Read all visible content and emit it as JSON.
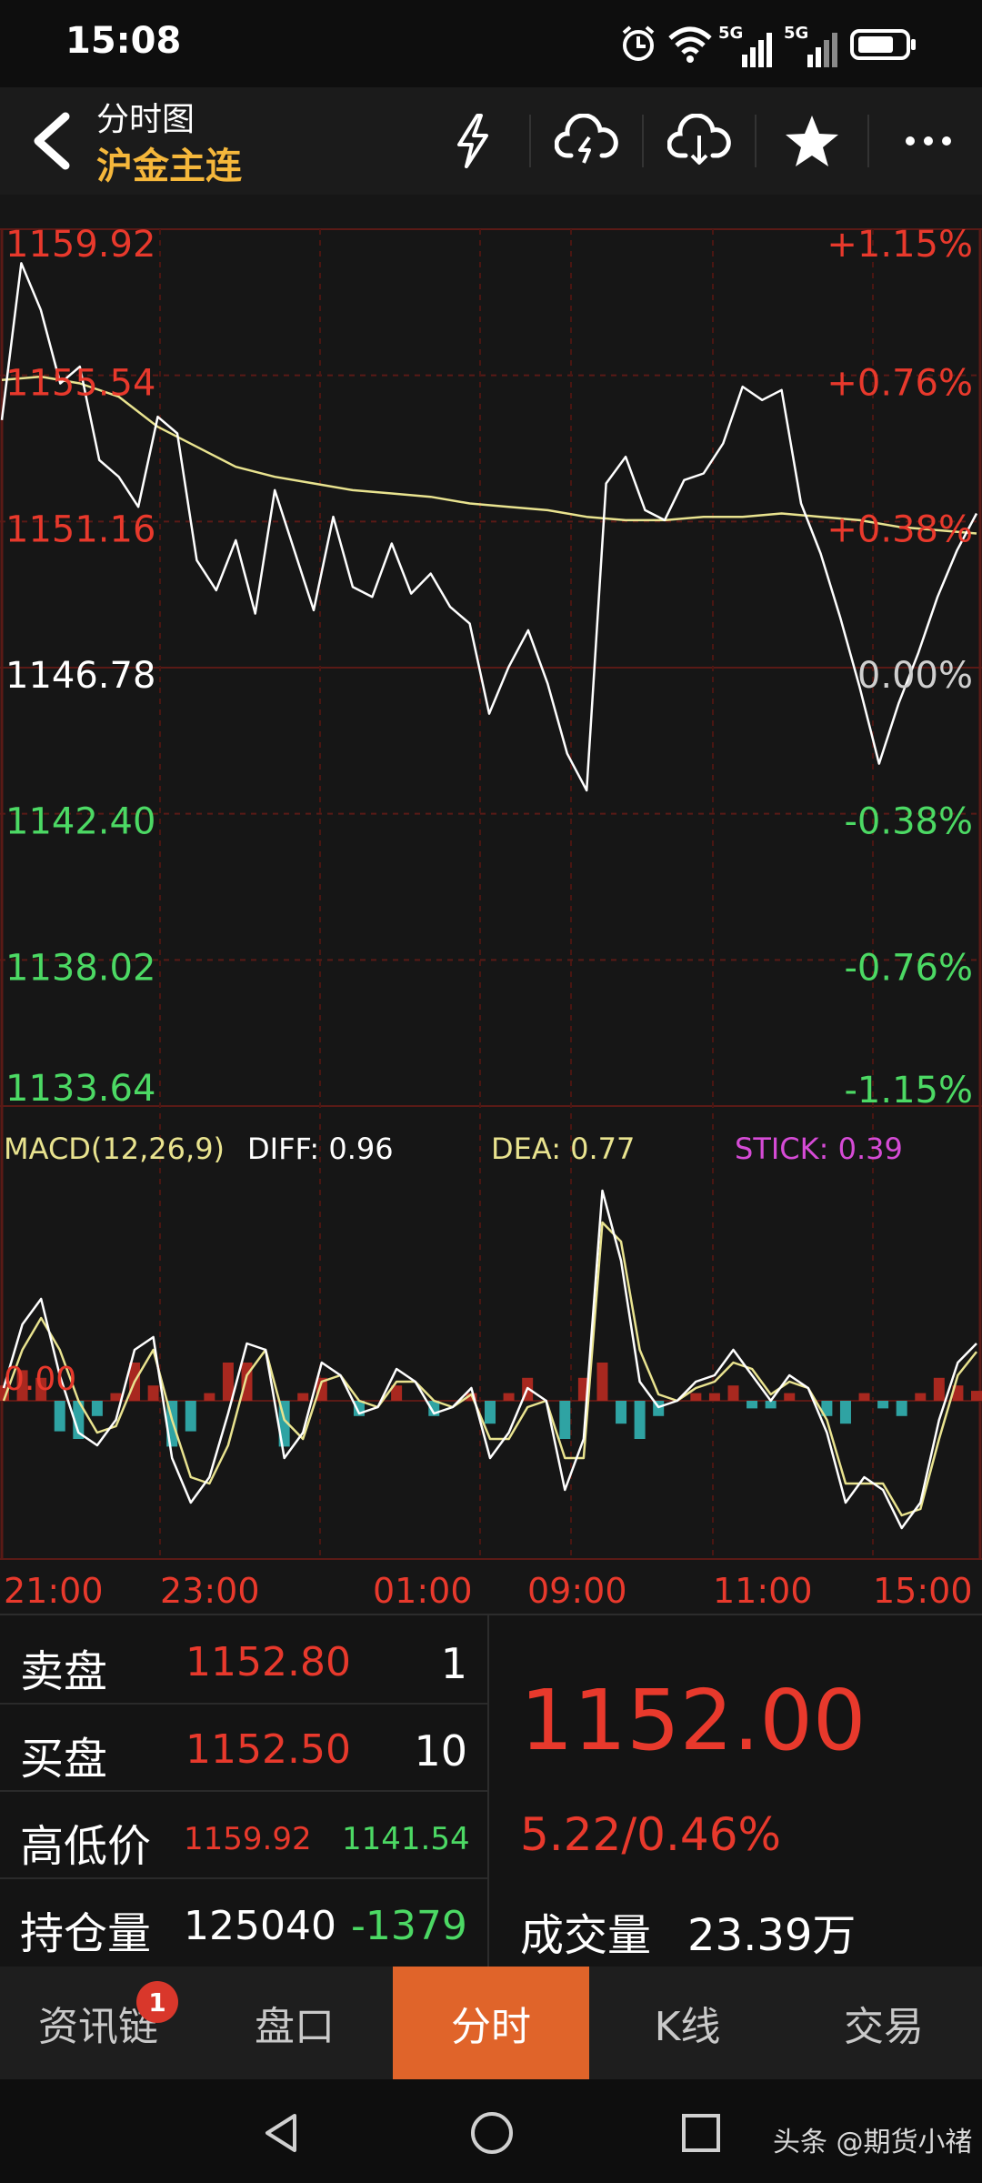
{
  "status_bar": {
    "time": "15:08",
    "net1": "5G",
    "net2": "5G"
  },
  "header": {
    "title": "分时图",
    "subtitle": "沪金主连",
    "icons": [
      "back-chevron-icon",
      "lightning-icon",
      "cloud-upload-icon",
      "cloud-download-icon",
      "star-icon",
      "more-icon"
    ]
  },
  "chart": {
    "price_left": [
      "1159.92",
      "1155.54",
      "1151.16",
      "1146.78",
      "1142.40",
      "1138.02",
      "1133.64"
    ],
    "pct_right": [
      "+1.15%",
      "+0.76%",
      "+0.38%",
      "0.00%",
      "-0.38%",
      "-0.76%",
      "-1.15%"
    ],
    "time_labels": [
      "21:00",
      "23:00",
      "01:00",
      "09:00",
      "11:00",
      "15:00"
    ],
    "macd": {
      "label": "MACD(12,26,9)",
      "diff": "DIFF: 0.96",
      "dea": "DEA: 0.77",
      "stick": "STICK: 0.39",
      "zero": "0.00"
    },
    "colors": {
      "up": "#e8392c",
      "down": "#4cd964",
      "price_line": "#ffffff",
      "avg_line": "#e9e38f",
      "dea_line": "#e9e38f",
      "stick_label": "#d64bd6",
      "hist_up": "#a8281f",
      "hist_down": "#2fa3a3"
    }
  },
  "chart_data": {
    "type": "line",
    "title": "",
    "x_ticks": [
      "21:00",
      "23:00",
      "01:00",
      "09:00",
      "11:00",
      "15:00"
    ],
    "ylim": [
      1133.64,
      1159.92
    ],
    "series": [
      {
        "values": [
          1154.2,
          1158.9,
          1157.5,
          1155.3,
          1155.8,
          1153.0,
          1152.5,
          1151.6,
          1154.3,
          1153.8,
          1150.0,
          1149.1,
          1150.6,
          1148.4,
          1152.1,
          1150.3,
          1148.5,
          1151.3,
          1149.2,
          1148.9,
          1150.5,
          1149.0,
          1149.6,
          1148.6,
          1148.1,
          1145.4,
          1146.8,
          1147.9,
          1146.3,
          1144.2,
          1143.1,
          1152.3,
          1153.1,
          1151.5,
          1151.2,
          1152.4,
          1152.6,
          1153.5,
          1155.2,
          1154.8,
          1155.1,
          1151.7,
          1150.2,
          1148.3,
          1146.2,
          1143.9,
          1145.7,
          1147.2,
          1148.9,
          1150.3,
          1151.4
        ]
      },
      {
        "values": [
          1155.4,
          1155.5,
          1155.3,
          1154.9,
          1154.0,
          1153.4,
          1152.8,
          1152.5,
          1152.3,
          1152.1,
          1152.0,
          1151.9,
          1151.7,
          1151.6,
          1151.5,
          1151.3,
          1151.2,
          1151.2,
          1151.3,
          1151.3,
          1151.4,
          1151.3,
          1151.2,
          1151.0,
          1150.9,
          1150.8
        ]
      }
    ],
    "macd": {
      "diff": 0.96,
      "dea": 0.77,
      "stick": 0.39,
      "diff_series": [
        0.2,
        1.2,
        1.6,
        0.4,
        -0.5,
        -0.7,
        -0.3,
        0.8,
        1.0,
        -0.9,
        -1.6,
        -1.2,
        -0.2,
        0.9,
        0.8,
        -0.9,
        -0.5,
        0.6,
        0.4,
        -0.2,
        -0.1,
        0.5,
        0.3,
        -0.2,
        -0.1,
        0.2,
        -0.9,
        -0.5,
        0.2,
        0.0,
        -1.4,
        -0.6,
        3.3,
        2.2,
        0.3,
        -0.1,
        0.0,
        0.3,
        0.4,
        0.8,
        0.4,
        0.0,
        0.4,
        0.2,
        -0.5,
        -1.6,
        -1.2,
        -1.4,
        -2.0,
        -1.6,
        -0.3,
        0.6,
        0.9
      ],
      "dea_series": [
        0.0,
        0.8,
        1.3,
        0.8,
        0.0,
        -0.5,
        -0.4,
        0.3,
        0.8,
        -0.3,
        -1.2,
        -1.3,
        -0.7,
        0.4,
        0.8,
        -0.3,
        -0.6,
        0.3,
        0.4,
        0.0,
        -0.1,
        0.3,
        0.3,
        0.0,
        -0.1,
        0.1,
        -0.6,
        -0.6,
        -0.1,
        0.0,
        -0.9,
        -0.9,
        2.8,
        2.5,
        0.8,
        0.1,
        0.0,
        0.2,
        0.3,
        0.6,
        0.5,
        0.1,
        0.3,
        0.2,
        -0.3,
        -1.3,
        -1.3,
        -1.3,
        -1.8,
        -1.7,
        -0.6,
        0.4,
        0.77
      ]
    }
  },
  "quote": {
    "ask_label": "卖盘",
    "ask_price": "1152.80",
    "ask_qty": "1",
    "bid_label": "买盘",
    "bid_price": "1152.50",
    "bid_qty": "10",
    "hl_label": "高低价",
    "high": "1159.92",
    "low": "1141.54",
    "oi_label": "持仓量",
    "oi": "125040",
    "oi_change": "-1379",
    "last_price": "1152.00",
    "change": "5.22/0.46%",
    "volume_label": "成交量",
    "volume": "23.39万"
  },
  "tabs": [
    {
      "label": "资讯链",
      "badge": "1"
    },
    {
      "label": "盘口"
    },
    {
      "label": "分时",
      "active": true
    },
    {
      "label": "K线"
    },
    {
      "label": "交易"
    }
  ],
  "watermark": "头条 @期货小禇"
}
